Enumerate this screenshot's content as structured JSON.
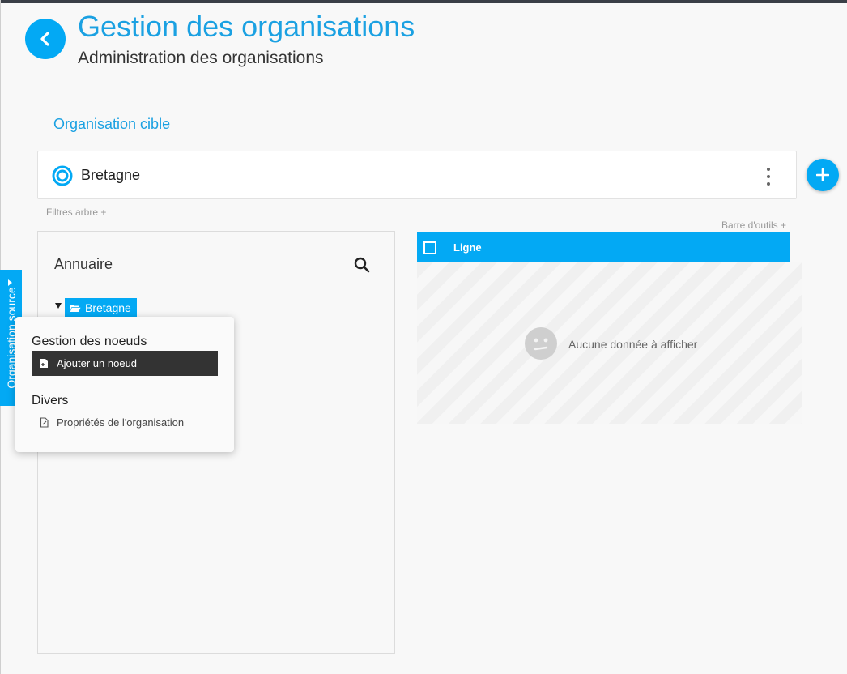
{
  "header": {
    "title": "Gestion des organisations",
    "subtitle": "Administration des organisations"
  },
  "target": {
    "label": "Organisation cible",
    "organisation_name": "Bretagne"
  },
  "links": {
    "tree_filters": "Filtres arbre +",
    "toolbar": "Barre d'outils +"
  },
  "side_tab": {
    "label": "Organisation source"
  },
  "annuaire": {
    "title": "Annuaire",
    "tree": [
      {
        "label": "Bretagne",
        "expanded": true,
        "selected": true
      }
    ]
  },
  "grid": {
    "columns": [
      "Ligne"
    ],
    "empty_message": "Aucune donnée à afficher"
  },
  "context_menu": {
    "groups": [
      {
        "heading": "Gestion des noeuds",
        "items": [
          {
            "label": "Ajouter un noeud",
            "active": true
          }
        ]
      },
      {
        "heading": "Divers",
        "items": [
          {
            "label": "Propriétés de l'organisation",
            "active": false
          }
        ]
      }
    ]
  },
  "colors": {
    "accent": "#03a9f4",
    "title": "#1ba1e2",
    "menu_active": "#333333"
  },
  "icons": [
    "chevron-left-icon",
    "target-circle-icon",
    "more-vert-icon",
    "plus-icon",
    "search-icon",
    "folder-open-icon",
    "add-node-icon",
    "properties-icon",
    "neutral-face-icon"
  ]
}
